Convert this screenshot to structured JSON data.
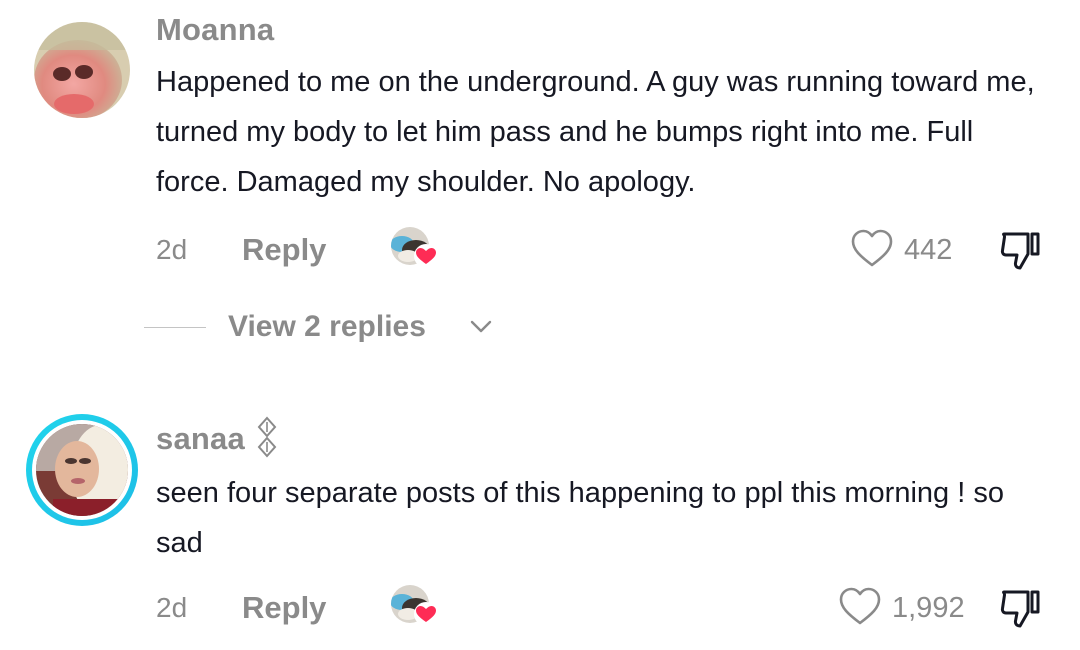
{
  "comments": [
    {
      "username": "Moanna",
      "text": "Happened to me on the underground. A guy was running toward me, turned my body to let him pass and he bumps right into me. Full force. Damaged my shoulder. No apology.",
      "time": "2d",
      "reply_label": "Reply",
      "like_count": "442",
      "view_replies_label": "View 2 replies"
    },
    {
      "username": "sanaa",
      "text": "seen four separate posts of this happening to ppl this morning ! so sad",
      "time": "2d",
      "reply_label": "Reply",
      "like_count": "1,992"
    }
  ],
  "icons": {
    "like": "heart-outline-icon",
    "dislike": "thumbs-down-icon",
    "creator_liked": "creator-liked-heart-icon",
    "expand": "chevron-down-icon",
    "username_badge": "diamond-badge-icon"
  },
  "colors": {
    "heart_badge": "#fe2c55",
    "story_ring_start": "#20d5ec",
    "story_ring_end": "#1ebde6",
    "muted_text": "#8a8a8a",
    "body_text": "#161823"
  }
}
